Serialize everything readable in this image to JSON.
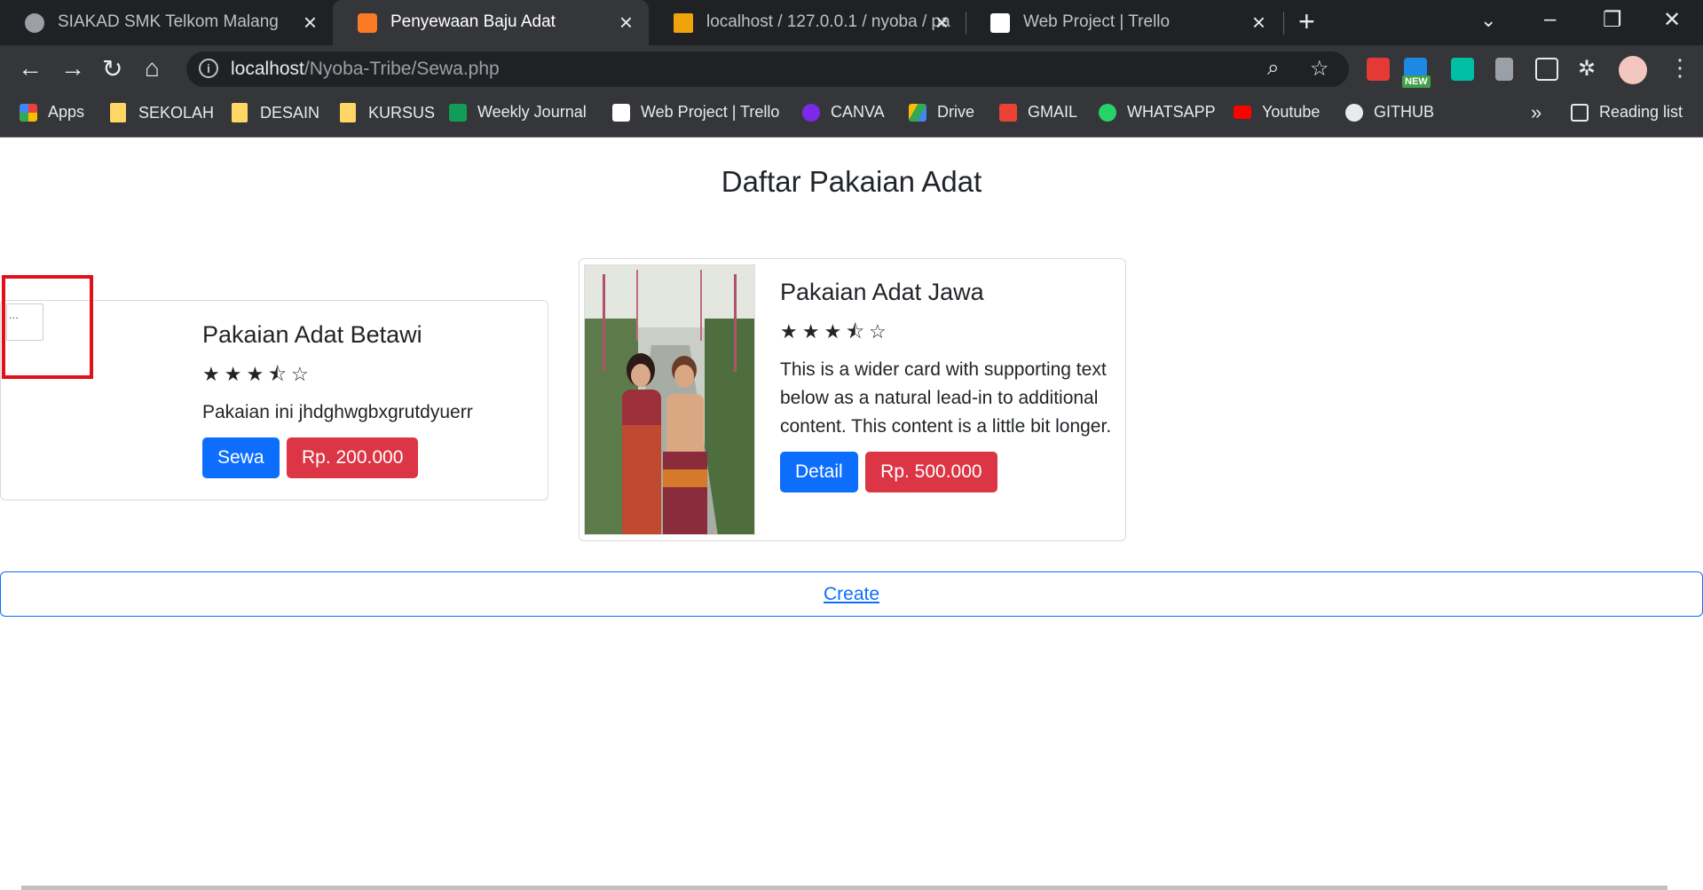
{
  "browser": {
    "tabs": [
      {
        "title": "SIAKAD SMK Telkom Malang",
        "active": false
      },
      {
        "title": "Penyewaan Baju Adat",
        "active": true
      },
      {
        "title": "localhost / 127.0.0.1 / nyoba / pa",
        "active": false
      },
      {
        "title": "Web Project | Trello",
        "active": false
      }
    ],
    "url_host": "localhost",
    "url_path": "/Nyoba-Tribe/Sewa.php",
    "bookmarks": [
      {
        "label": "Apps",
        "icon": "apps-grid-icon"
      },
      {
        "label": "SEKOLAH",
        "icon": "folder-icon"
      },
      {
        "label": "DESAIN",
        "icon": "folder-icon"
      },
      {
        "label": "KURSUS",
        "icon": "folder-icon"
      },
      {
        "label": "Weekly Journal",
        "icon": "sheets-icon"
      },
      {
        "label": "Web Project | Trello",
        "icon": "trello-icon"
      },
      {
        "label": "CANVA",
        "icon": "canva-icon"
      },
      {
        "label": "Drive",
        "icon": "drive-icon"
      },
      {
        "label": "GMAIL",
        "icon": "gmail-icon"
      },
      {
        "label": "WHATSAPP",
        "icon": "whatsapp-icon"
      },
      {
        "label": "Youtube",
        "icon": "youtube-icon"
      },
      {
        "label": "GITHUB",
        "icon": "github-icon"
      }
    ],
    "more": "»",
    "reading_list": "Reading list",
    "ext_badge": "NEW"
  },
  "page": {
    "heading": "Daftar Pakaian Adat",
    "cards": [
      {
        "title": "Pakaian Adat Betawi",
        "rating_stars": "★★★⯪☆",
        "text": "Pakaian ini jhdghwgbxgrutdyuerr",
        "primary_label": "Sewa",
        "price_label": "Rp. 200.000",
        "img_alt": "..."
      },
      {
        "title": "Pakaian Adat Jawa",
        "rating_stars": "★★★⯪☆",
        "text": "This is a wider card with supporting text below as a natural lead-in to additional content. This content is a little bit longer.",
        "primary_label": "Detail",
        "price_label": "Rp. 500.000"
      }
    ],
    "create_label": "Create"
  },
  "colors": {
    "primary": "#0d6efd",
    "danger": "#dc3545",
    "highlight": "#e3101a"
  }
}
